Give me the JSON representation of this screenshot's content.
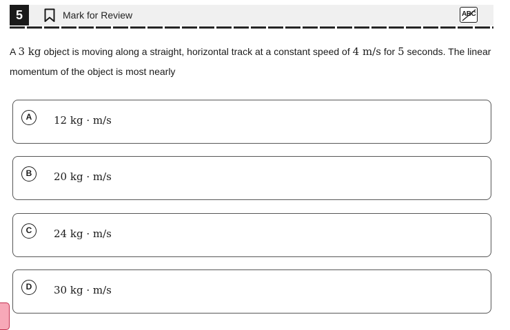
{
  "header": {
    "question_number": "5",
    "mark_for_review_label": "Mark for Review",
    "abc_label": "ABC"
  },
  "question": {
    "text_1": "A ",
    "mass": "3 kg",
    "text_2": " object is moving along a straight, horizontal track at a constant speed of ",
    "speed": "4 m/s",
    "text_3": " for ",
    "time": "5",
    "text_4": " seconds. The linear momentum of the object is most nearly"
  },
  "options": [
    {
      "letter": "A",
      "value": "12 kg · m/s"
    },
    {
      "letter": "B",
      "value": "20 kg · m/s"
    },
    {
      "letter": "C",
      "value": "24 kg · m/s"
    },
    {
      "letter": "D",
      "value": "30 kg · m/s"
    }
  ],
  "icons": {
    "bookmark": "bookmark-icon",
    "abc": "strikethrough-abc-icon"
  },
  "colors": {
    "header_bg": "#f0f0f0",
    "number_bg": "#1a1a1a",
    "corner_tab": "#f7a8b8"
  }
}
